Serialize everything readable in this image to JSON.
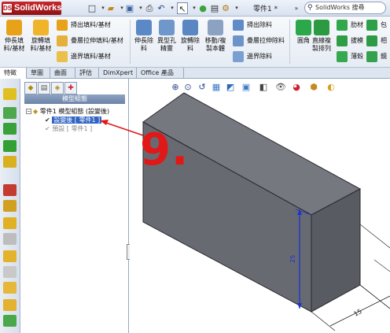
{
  "titlebar": {
    "app_name": "SolidWorks",
    "doc_title": "零件1 *",
    "search_placeholder": "SolidWorks 搜尋"
  },
  "ribbon": {
    "big_buttons": [
      {
        "label": "伸長填\n料/基材",
        "color": "#e8a21a"
      },
      {
        "label": "旋轉填\n料/基材",
        "color": "#f0b42a"
      },
      {
        "label": "伸長除\n料",
        "color": "#5b88c7"
      },
      {
        "label": "異型孔\n精靈",
        "color": "#6f97cc"
      },
      {
        "label": "旋轉除\n料",
        "color": "#5a86c1"
      },
      {
        "label": "移動/複\n製本體",
        "color": "#8ba2c3"
      },
      {
        "label": "圓角",
        "color": "#2aa84a"
      },
      {
        "label": "直線複\n製排列",
        "color": "#2b9a42"
      }
    ],
    "small_buttons": [
      {
        "label": "掃出填料/基材",
        "color": "#e8a21a"
      },
      {
        "label": "疊層拉伸填料/基材",
        "color": "#e6b13a"
      },
      {
        "label": "邊界填料/基材",
        "color": "#ebc04a"
      },
      {
        "label": "掃出除料",
        "color": "#5f8cc9"
      },
      {
        "label": "疊層拉伸除料",
        "color": "#6c94cb"
      },
      {
        "label": "邊界除料",
        "color": "#7a9fd1"
      },
      {
        "label": "肋材",
        "color": "#31a84c"
      },
      {
        "label": "拔模",
        "color": "#2f9d46"
      },
      {
        "label": "薄殼",
        "color": "#35a850"
      },
      {
        "label": "包",
        "color": "#2fa04a"
      },
      {
        "label": "相",
        "color": "#2d9b45"
      },
      {
        "label": "鏡",
        "color": "#34a24d"
      }
    ]
  },
  "tabs": [
    "特徵",
    "草圖",
    "曲面",
    "評估",
    "DimXpert",
    "Office 產品"
  ],
  "feature_manager": {
    "title": "模型組態",
    "root": "零件1 模型組態  (設變後)",
    "items": [
      "設變後 [ 零件1 ]",
      "預設 [ 零件1 ]"
    ]
  },
  "annotation": {
    "number": "9."
  },
  "dimensions": {
    "height_label": "25",
    "width_label": "15"
  },
  "colors": {
    "accent_red": "#e01818",
    "selection_blue": "#2f63c4",
    "dimension_blue": "#1a33d0",
    "box_front": "#6b6e76",
    "box_top": "#7a7d86",
    "box_side": "#585b62"
  }
}
